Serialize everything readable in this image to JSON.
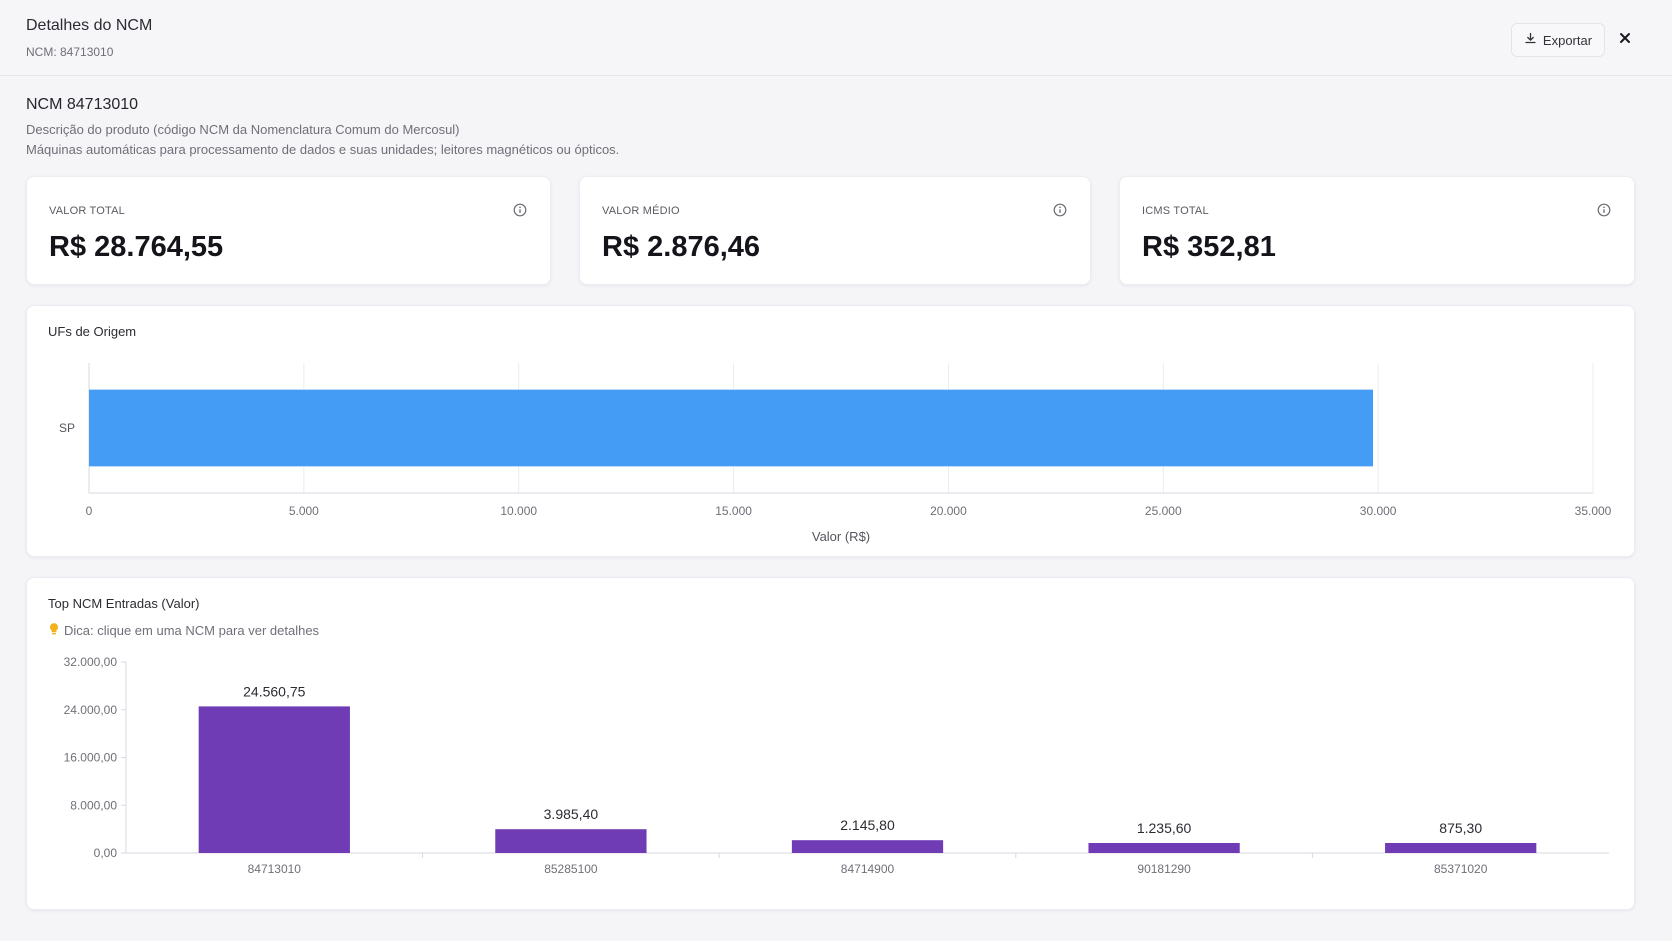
{
  "header": {
    "title": "Detalhes do NCM",
    "subtitle": "NCM: 84713010",
    "export_label": "Exportar"
  },
  "ncm": {
    "title": "NCM 84713010",
    "description_label": "Descrição do produto (código NCM da Nomenclatura Comum do Mercosul)",
    "description": "Máquinas automáticas para processamento de dados e suas unidades; leitores magnéticos ou ópticos."
  },
  "stats": [
    {
      "label": "VALOR TOTAL",
      "value": "R$ 28.764,55"
    },
    {
      "label": "VALOR MÉDIO",
      "value": "R$ 2.876,46"
    },
    {
      "label": "ICMS TOTAL",
      "value": "R$ 352,81"
    }
  ],
  "icons": {
    "export": "download-icon",
    "close": "close-icon",
    "info": "info-icon",
    "hint": "lightbulb-icon"
  },
  "colors": {
    "uf_bar": "#449cf5",
    "ncm_bar": "#6f3cb6",
    "hint_icon": "#f2b21d"
  },
  "uf_chart_title": "UFs de Origem",
  "ncm_chart_title": "Top NCM Entradas (Valor)",
  "ncm_hint": "Dica: clique em uma NCM para ver detalhes",
  "chart_data": [
    {
      "type": "bar",
      "orientation": "horizontal",
      "title": "UFs de Origem",
      "categories": [
        "SP"
      ],
      "values": [
        29880
      ],
      "xlabel": "Valor (R$)",
      "ylabel": "",
      "xlim": [
        0,
        35000
      ],
      "x_ticks": [
        "0",
        "5.000",
        "10.000",
        "15.000",
        "20.000",
        "25.000",
        "30.000",
        "35.000"
      ],
      "grid": true
    },
    {
      "type": "bar",
      "title": "Top NCM Entradas (Valor)",
      "categories": [
        "84713010",
        "85285100",
        "84714900",
        "90181290",
        "85371020"
      ],
      "values": [
        24560.75,
        3985.4,
        2145.8,
        1235.6,
        875.3
      ],
      "data_labels": [
        "24.560,75",
        "3.985,40",
        "2.145,80",
        "1.235,60",
        "875,30"
      ],
      "ylim": [
        0,
        32000
      ],
      "y_ticks": [
        "0,00",
        "8.000,00",
        "16.000,00",
        "24.000,00",
        "32.000,00"
      ],
      "xlabel": "",
      "ylabel": "",
      "grid": false
    }
  ]
}
